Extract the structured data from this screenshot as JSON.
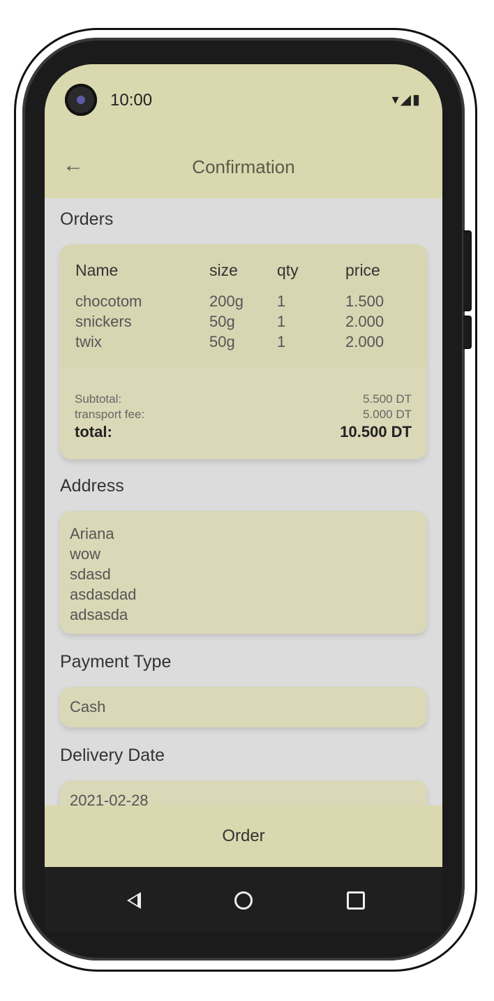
{
  "status_bar": {
    "time": "10:00",
    "icons": "▾◢▮"
  },
  "app_bar": {
    "back_icon": "←",
    "title": "Confirmation"
  },
  "orders": {
    "section_title": "Orders",
    "columns": [
      "Name",
      "size",
      "qty",
      "price"
    ],
    "rows": [
      [
        "chocotom",
        "200g",
        "1",
        "1.500"
      ],
      [
        "snickers",
        "50g",
        "1",
        "2.000"
      ],
      [
        "twix",
        "50g",
        "1",
        "2.000"
      ]
    ],
    "subtotal_label": "Subtotal:",
    "subtotal_value": "5.500 DT",
    "transport_label": "transport fee:",
    "transport_value": "5.000 DT",
    "total_label": "total:",
    "total_value": "10.500 DT"
  },
  "address": {
    "section_title": "Address",
    "lines": [
      "Ariana",
      "wow",
      "sdasd",
      "asdasdad",
      "adsasda"
    ]
  },
  "payment": {
    "section_title": "Payment Type",
    "value": "Cash"
  },
  "delivery": {
    "section_title": "Delivery Date",
    "value": "2021-02-28"
  },
  "order_button": {
    "label": "Order"
  },
  "colors": {
    "accent": "#dad8ae",
    "card": "#dad8b6",
    "background": "#dcdcdc"
  }
}
